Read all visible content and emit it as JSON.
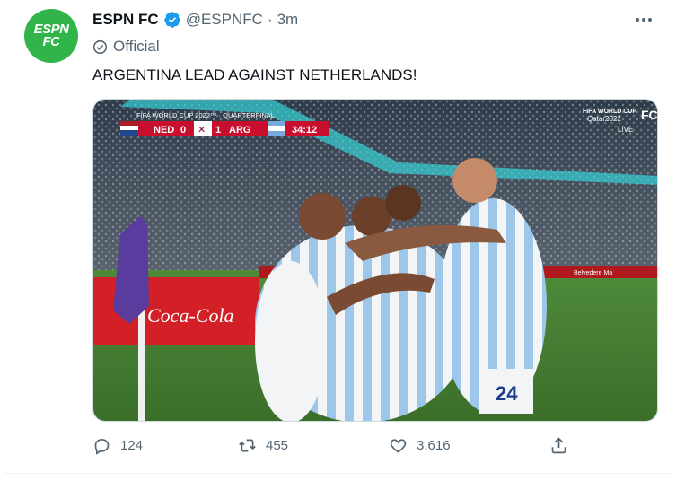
{
  "user": {
    "display_name": "ESPN FC",
    "handle": "@ESPNFC",
    "separator": "·",
    "time": "3m",
    "avatar_text_line1": "ESPN",
    "avatar_text_line2": "FC",
    "label": "Official"
  },
  "tweet": {
    "text": "ARGENTINA LEAD AGAINST NETHERLANDS!"
  },
  "media": {
    "scoreboard": {
      "competition": "FIFA WORLD CUP 2022™ · QUARTERFINAL",
      "team_home": "NED",
      "score_home": "0",
      "score_away": "1",
      "team_away": "ARG",
      "clock": "34:12"
    },
    "broadcast_logo_line1": "FIFA WORLD CUP",
    "broadcast_logo_line2": "Qatar2022",
    "broadcast_badge": "FC",
    "live_label": "LIVE",
    "ad_board": "Coca-Cola",
    "ad_board_right": "Belvedere Ma"
  },
  "actions": {
    "reply_count": "124",
    "retweet_count": "455",
    "like_count": "3,616"
  },
  "icons": {
    "reply": "reply-icon",
    "retweet": "retweet-icon",
    "like": "heart-icon",
    "share": "share-icon",
    "verified": "verified-badge-icon",
    "official": "official-check-icon",
    "more": "more-options-icon"
  },
  "colors": {
    "verified_blue": "#1d9bf0",
    "avatar_green": "#31b54a",
    "secondary_text": "#536471",
    "scoreboard_red": "#c8102e"
  }
}
